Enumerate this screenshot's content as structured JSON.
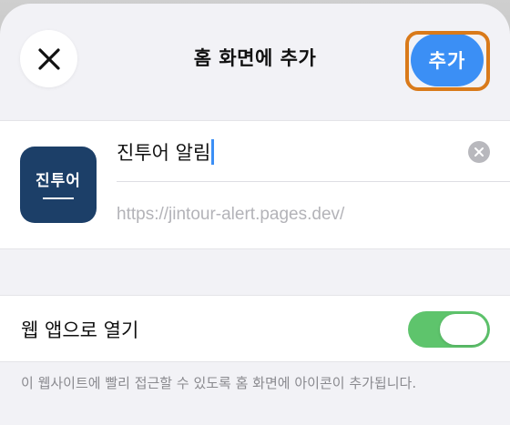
{
  "header": {
    "title": "홈 화면에 추가",
    "add_label": "추가",
    "close_icon": "close-icon"
  },
  "app": {
    "icon_text": "진투어",
    "name_value": "진투어 알림",
    "url": "https://jintour-alert.pages.dev/"
  },
  "settings": {
    "open_as_web_app_label": "웹 앱으로 열기",
    "open_as_web_app_enabled": true,
    "footnote": "이 웹사이트에 빨리 접근할 수 있도록 홈 화면에 아이콘이 추가됩니다."
  },
  "colors": {
    "accent": "#3b8ff5",
    "toggle_on": "#5ec46c",
    "highlight": "#d97a1a",
    "app_icon_bg": "#1c3f68"
  }
}
